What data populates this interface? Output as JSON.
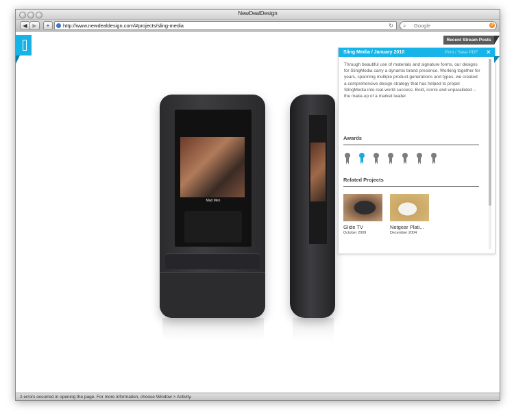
{
  "window": {
    "title": "NewDealDesign",
    "url": "http://www.newdealdesign.com/#projects/sling-media",
    "search_placeholder": "Google",
    "status": "2 errors occurred in opening the page. For more information, choose Window > Activity."
  },
  "toolbar": {
    "back_icon": "back-arrow-icon",
    "forward_icon": "forward-arrow-icon",
    "add_icon": "plus-icon",
    "reload_icon": "reload-icon"
  },
  "stream": {
    "label": "Recent Stream Posts"
  },
  "panel": {
    "title": "Sling Media / January 2010",
    "print_label": "Print / Save PDF",
    "description": "Through beautiful use of materials and signature forms, our designs for SlingMedia carry a dynamic brand presence. Working together for years, spanning multiple product generations and types, we created a comprehensive design strategy that has helped to propel SlingMedia into real-world success. Bold, iconic and unparalleled – the make-up of a market leader.",
    "awards_title": "Awards",
    "awards": [
      {
        "active": false
      },
      {
        "active": true
      },
      {
        "active": false
      },
      {
        "active": false
      },
      {
        "active": false
      },
      {
        "active": false
      },
      {
        "active": false
      }
    ],
    "related_title": "Related Projects",
    "related": [
      {
        "name": "Glide TV",
        "date": "October 2009"
      },
      {
        "name": "Netgear Plati...",
        "date": "December 2004"
      }
    ]
  },
  "device": {
    "screen_caption": "Mad Men"
  },
  "colors": {
    "accent": "#16b4e8",
    "dark_tab": "#5a5a5a"
  }
}
